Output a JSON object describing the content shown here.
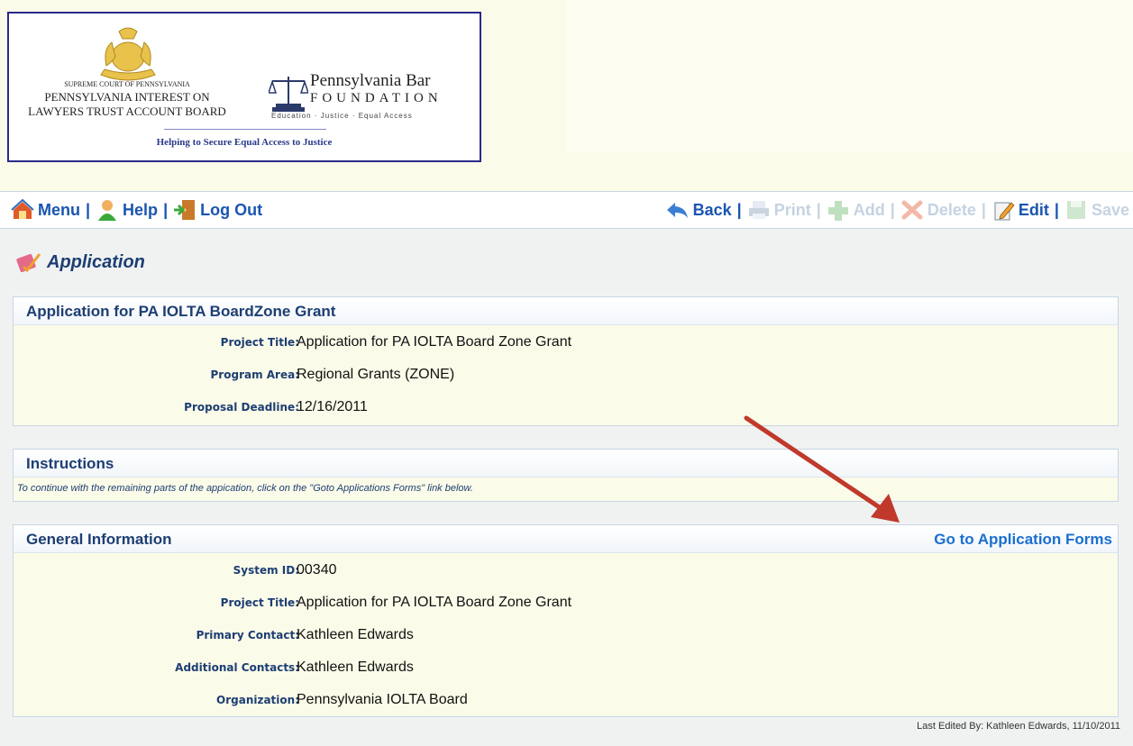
{
  "header": {
    "court_line1": "SUPREME COURT OF PENNSYLVANIA",
    "court_line2": "PENNSYLVANIA INTEREST ON",
    "court_line3": "LAWYERS TRUST ACCOUNT BOARD",
    "foundation_name": "Pennsylvania Bar",
    "foundation_word": "FOUNDATION",
    "foundation_tagline": "Education · Justice · Equal Access",
    "subtitle": "Helping to Secure Equal Access to Justice"
  },
  "toolbar": {
    "left": [
      {
        "label": "Menu",
        "icon": "menu-icon"
      },
      {
        "label": "Help",
        "icon": "help-icon"
      },
      {
        "label": "Log Out",
        "icon": "log-out-icon"
      }
    ],
    "right": [
      {
        "label": "Back",
        "icon": "back-arrow-icon",
        "enabled": true
      },
      {
        "label": "Print",
        "icon": "printer-icon",
        "enabled": false
      },
      {
        "label": "Add",
        "icon": "add-icon",
        "enabled": false
      },
      {
        "label": "Delete",
        "icon": "delete-icon",
        "enabled": false
      },
      {
        "label": "Edit",
        "icon": "edit-icon",
        "enabled": true
      },
      {
        "label": "Save",
        "icon": "save-icon",
        "enabled": false
      }
    ]
  },
  "page": {
    "title": "Application"
  },
  "summary": {
    "title": "Application for PA IOLTA BoardZone Grant",
    "fields": [
      {
        "label": "Project Title:",
        "value": "Application for PA IOLTA Board Zone Grant"
      },
      {
        "label": "Program Area:",
        "value": "Regional Grants (ZONE)"
      },
      {
        "label": "Proposal Deadline:",
        "value": "12/16/2011"
      }
    ]
  },
  "instructions": {
    "title": "Instructions",
    "text": "To continue with the remaining parts of the appication, click on the \"Goto Applications Forms\" link below."
  },
  "general": {
    "title": "General Information",
    "link": "Go to Application Forms",
    "fields": [
      {
        "label": "System ID:",
        "value": "00340"
      },
      {
        "label": "Project Title:",
        "value": "Application for PA IOLTA Board Zone Grant"
      },
      {
        "label": "Primary Contact:",
        "value": "Kathleen Edwards"
      },
      {
        "label": "Additional Contacts:",
        "value": "Kathleen Edwards"
      },
      {
        "label": "Organization:",
        "value": "Pennsylvania IOLTA Board"
      }
    ]
  },
  "footer": {
    "last_edited": "Last Edited By: Kathleen Edwards, 11/10/2011"
  },
  "colors": {
    "link_blue": "#1a55b0",
    "heading_navy": "#1d3e73",
    "disabled": "#c5d3e2",
    "annotation_arrow": "#c0392b"
  }
}
